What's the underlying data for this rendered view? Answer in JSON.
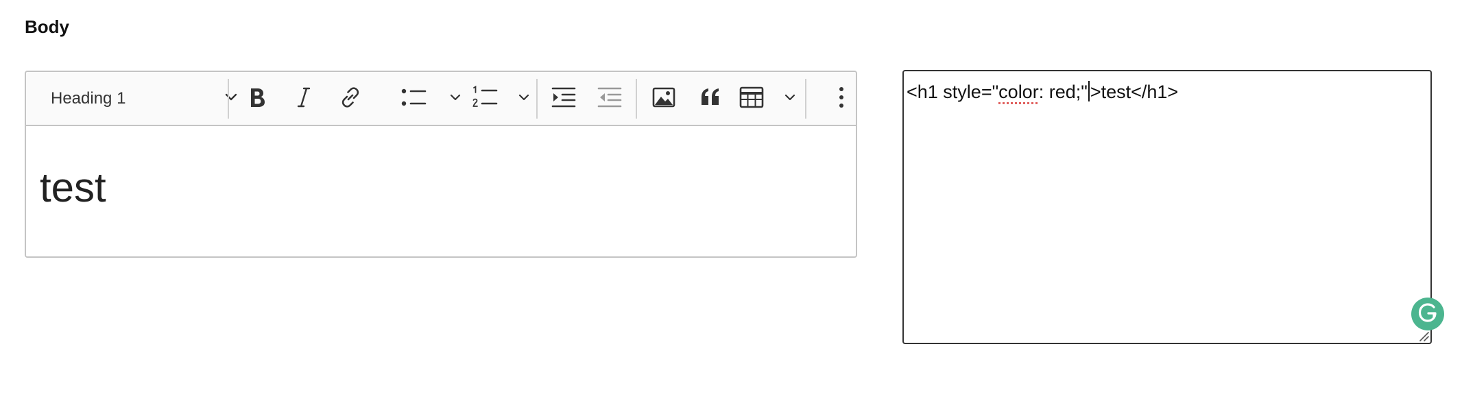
{
  "field": {
    "label": "Body"
  },
  "toolbar": {
    "heading_value": "Heading 1",
    "items": [
      "bold-icon",
      "italic-icon",
      "link-icon",
      "bulleted-list-icon",
      "numbered-list-icon",
      "increase-indent-icon",
      "decrease-indent-icon",
      "image-icon",
      "blockquote-icon",
      "table-icon",
      "more-options-icon"
    ]
  },
  "editor": {
    "content": "test"
  },
  "source": {
    "before_word": "<h1 style=\"",
    "misspelled_word": "color",
    "after_word": ": red;\"",
    "after_caret": ">test</h1>"
  },
  "colors": {
    "grammarly": "#4cb58f",
    "spell_underline": "#e0605e"
  }
}
